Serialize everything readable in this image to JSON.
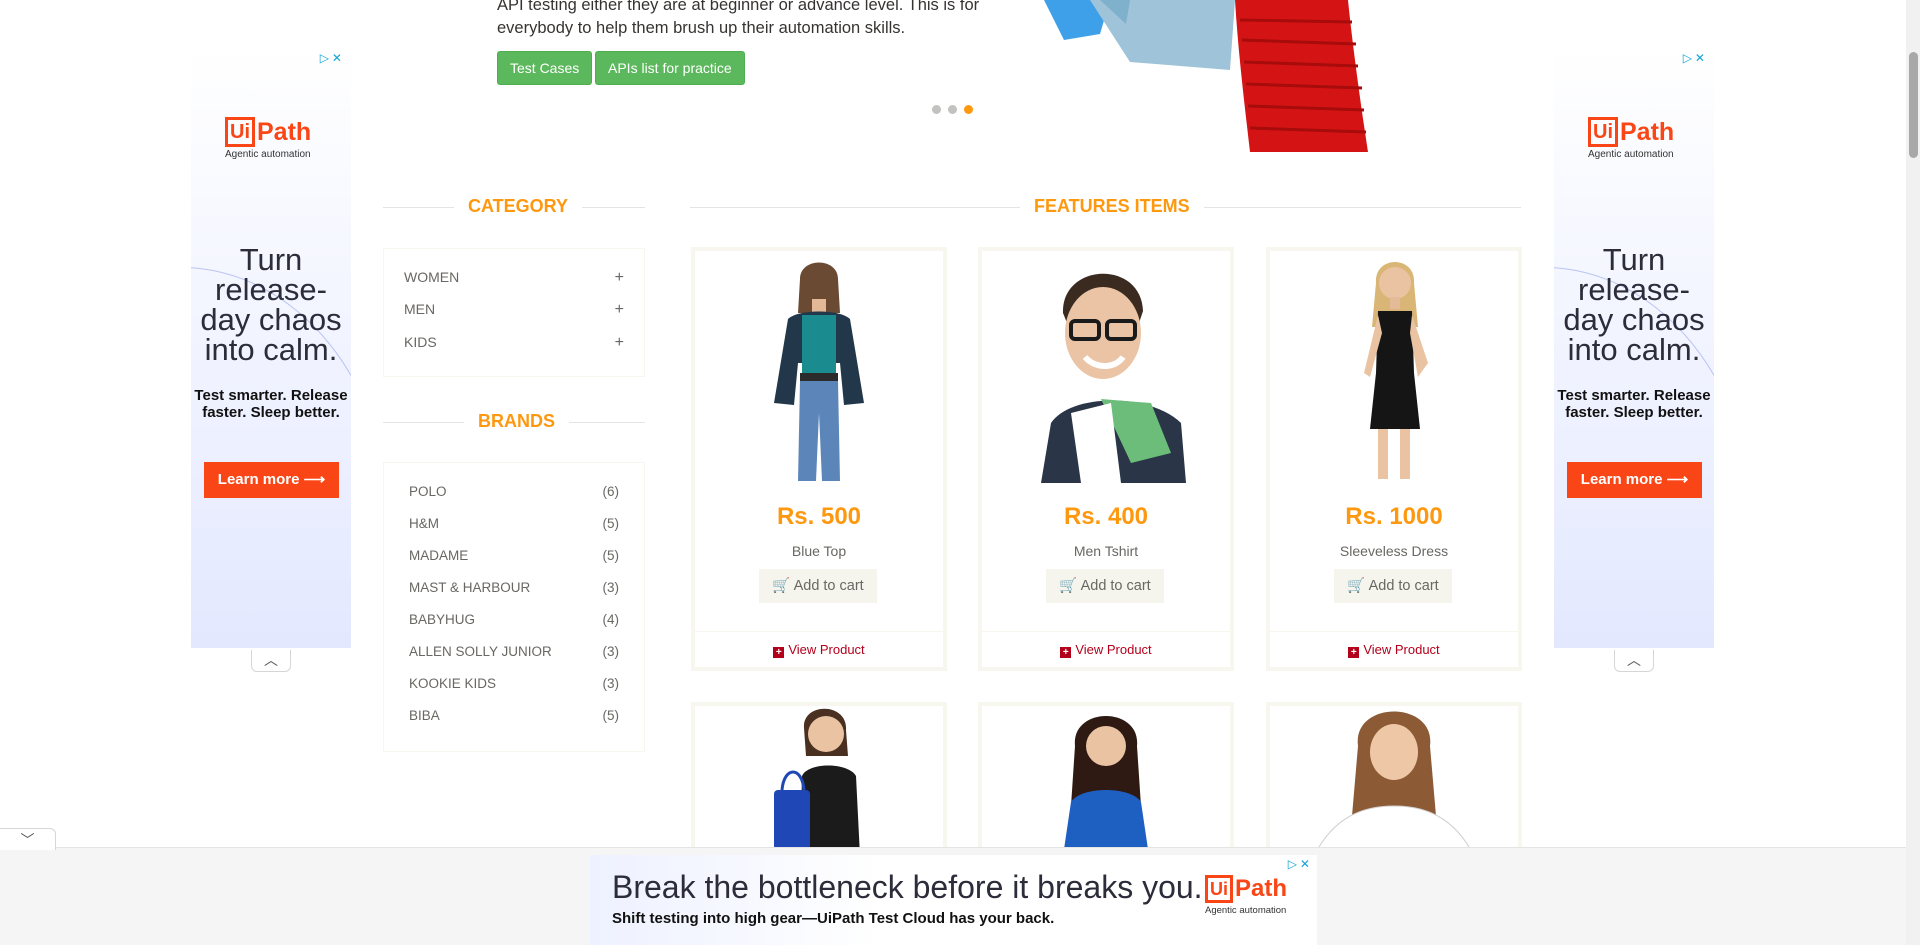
{
  "hero": {
    "text": "API testing either they are at beginner or advance level. This is for everybody to help them brush up their automation skills.",
    "buttons": [
      "Test Cases",
      "APIs list for practice"
    ],
    "slides": 3,
    "active_slide": 3
  },
  "side_ad": {
    "brand": "Ui",
    "brand_suffix": "Path",
    "brand_sub": "Agentic automation",
    "headline": "Turn release-day chaos into calm.",
    "tagline": "Test smarter. Release faster. Sleep better.",
    "cta": "Learn more"
  },
  "sidebar": {
    "category_title": "CATEGORY",
    "categories": [
      "WOMEN",
      "MEN",
      "KIDS"
    ],
    "brands_title": "BRANDS",
    "brands": [
      {
        "name": "POLO",
        "count": "(6)"
      },
      {
        "name": "H&M",
        "count": "(5)"
      },
      {
        "name": "MADAME",
        "count": "(5)"
      },
      {
        "name": "MAST & HARBOUR",
        "count": "(3)"
      },
      {
        "name": "BABYHUG",
        "count": "(4)"
      },
      {
        "name": "ALLEN SOLLY JUNIOR",
        "count": "(3)"
      },
      {
        "name": "KOOKIE KIDS",
        "count": "(3)"
      },
      {
        "name": "BIBA",
        "count": "(5)"
      }
    ]
  },
  "features": {
    "title": "FEATURES ITEMS",
    "add_to_cart": "Add to cart",
    "view_product": "View Product",
    "products": [
      {
        "price": "Rs. 500",
        "name": "Blue Top"
      },
      {
        "price": "Rs. 400",
        "name": "Men Tshirt"
      },
      {
        "price": "Rs. 1000",
        "name": "Sleeveless Dress"
      }
    ]
  },
  "bottom_ad": {
    "headline": "Break the bottleneck before it breaks you.",
    "tagline": "Shift testing into high gear—UiPath Test Cloud has your back.",
    "brand": "Ui",
    "brand_suffix": "Path",
    "brand_sub": "Agentic automation"
  },
  "colors": {
    "accent": "#fe980f",
    "green": "#5cb85c",
    "ad_orange": "#fa4616"
  }
}
